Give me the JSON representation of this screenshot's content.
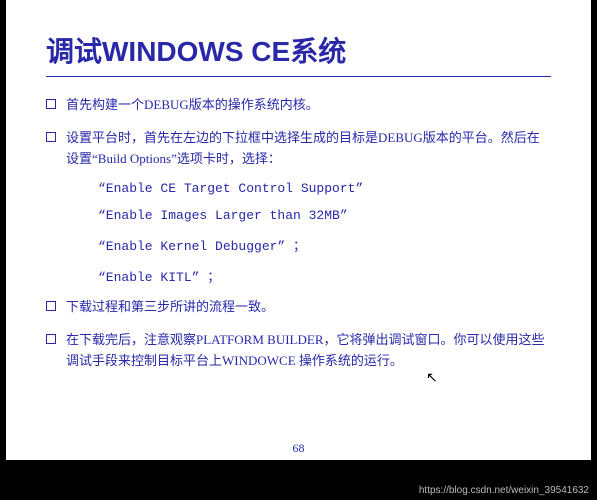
{
  "title": "调试WINDOWS CE系统",
  "bullets": [
    {
      "text": "首先构建一个DEBUG版本的操作系统内核。"
    },
    {
      "text": "设置平台时，首先在左边的下拉框中选择生成的目标是DEBUG版本的平台。然后在设置“Build Options”选项卡时，选择："
    }
  ],
  "subs": [
    "“Enable CE Target Control Support”",
    "“Enable Images Larger than 32MB”",
    "“Enable Kernel Debugger” ；",
    "“Enable KITL” ；"
  ],
  "bullets2": [
    {
      "text": "下载过程和第三步所讲的流程一致。"
    },
    {
      "text": "在下载完后，注意观察PLATFORM BUILDER，它将弹出调试窗口。你可以使用这些调试手段来控制目标平台上WINDOWCE 操作系统的运行。"
    }
  ],
  "pageNum": "68",
  "watermark": "https://blog.csdn.net/weixin_39541632"
}
